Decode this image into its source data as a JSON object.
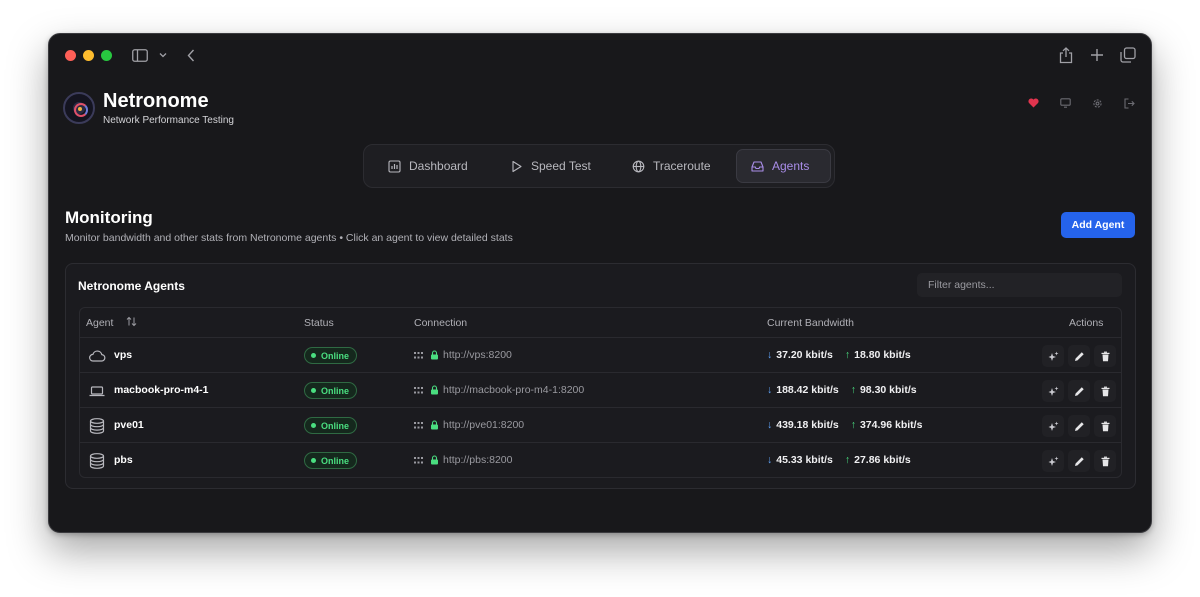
{
  "app": {
    "title": "Netronome",
    "subtitle": "Network Performance Testing"
  },
  "nav": {
    "tabs": [
      {
        "label": "Dashboard",
        "icon": "bar-chart-icon",
        "active": false
      },
      {
        "label": "Speed Test",
        "icon": "play-icon",
        "active": false
      },
      {
        "label": "Traceroute",
        "icon": "globe-icon",
        "active": false
      },
      {
        "label": "Agents",
        "icon": "inbox-icon",
        "active": true
      }
    ]
  },
  "monitoring": {
    "title": "Monitoring",
    "subtitle": "Monitor bandwidth and other stats from Netronome agents • Click an agent to view detailed stats",
    "add_button": "Add Agent"
  },
  "agents_card": {
    "title": "Netronome Agents",
    "filter_placeholder": "Filter agents...",
    "columns": {
      "agent": "Agent",
      "status": "Status",
      "connection": "Connection",
      "bandwidth": "Current Bandwidth",
      "actions": "Actions"
    },
    "rows": [
      {
        "name": "vps",
        "icon": "cloud-icon",
        "status": "Online",
        "url": "http://vps:8200",
        "down": "37.20 kbit/s",
        "up": "18.80 kbit/s"
      },
      {
        "name": "macbook-pro-m4-1",
        "icon": "laptop-icon",
        "status": "Online",
        "url": "http://macbook-pro-m4-1:8200",
        "down": "188.42 kbit/s",
        "up": "98.30 kbit/s"
      },
      {
        "name": "pve01",
        "icon": "database-icon",
        "status": "Online",
        "url": "http://pve01:8200",
        "down": "439.18 kbit/s",
        "up": "374.96 kbit/s"
      },
      {
        "name": "pbs",
        "icon": "database-icon",
        "status": "Online",
        "url": "http://pbs:8200",
        "down": "45.33 kbit/s",
        "up": "27.86 kbit/s"
      }
    ]
  },
  "colors": {
    "accent": "#a98de8",
    "primary_button": "#2563eb",
    "online": "#4ade80",
    "download": "#60a5fa",
    "upload": "#4ade80",
    "heart": "#e0344e"
  }
}
